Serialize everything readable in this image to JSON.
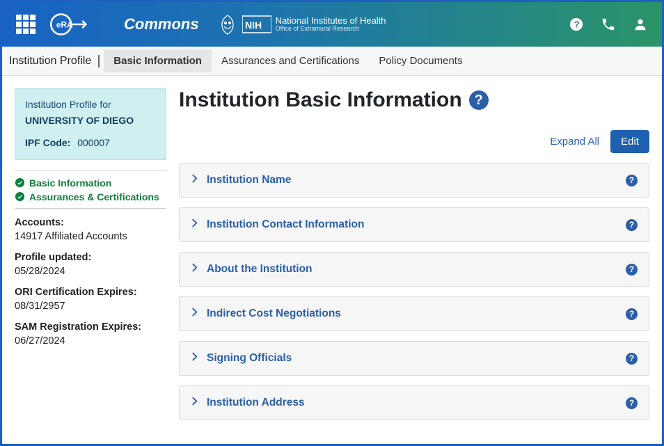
{
  "header": {
    "commons_label": "Commons",
    "nih_line1": "National Institutes of Health",
    "nih_line2": "Office of Extramural Research"
  },
  "subnav": {
    "title": "Institution Profile",
    "tabs": [
      {
        "label": "Basic Information",
        "active": true
      },
      {
        "label": "Assurances and Certifications",
        "active": false
      },
      {
        "label": "Policy Documents",
        "active": false
      }
    ]
  },
  "sidebar": {
    "profile_for_label": "Institution Profile for",
    "institution_name": "UNIVERSITY OF DIEGO",
    "ipf_label": "IPF Code:",
    "ipf_value": "000007",
    "status": [
      {
        "label": "Basic Information"
      },
      {
        "label": "Assurances & Certifications"
      }
    ],
    "meta": {
      "accounts_label": "Accounts:",
      "accounts_value": "14917 Affiliated Accounts",
      "profile_updated_label": "Profile updated:",
      "profile_updated_value": "05/28/2024",
      "ori_label": "ORI Certification Expires:",
      "ori_value": "08/31/2957",
      "sam_label": "SAM Registration Expires:",
      "sam_value": "06/27/2024"
    }
  },
  "main": {
    "title": "Institution Basic Information",
    "expand_all": "Expand All",
    "edit_label": "Edit",
    "accordions": [
      {
        "title": "Institution Name"
      },
      {
        "title": "Institution Contact Information"
      },
      {
        "title": "About the Institution"
      },
      {
        "title": "Indirect Cost Negotiations"
      },
      {
        "title": "Signing Officials"
      },
      {
        "title": "Institution Address"
      }
    ]
  }
}
